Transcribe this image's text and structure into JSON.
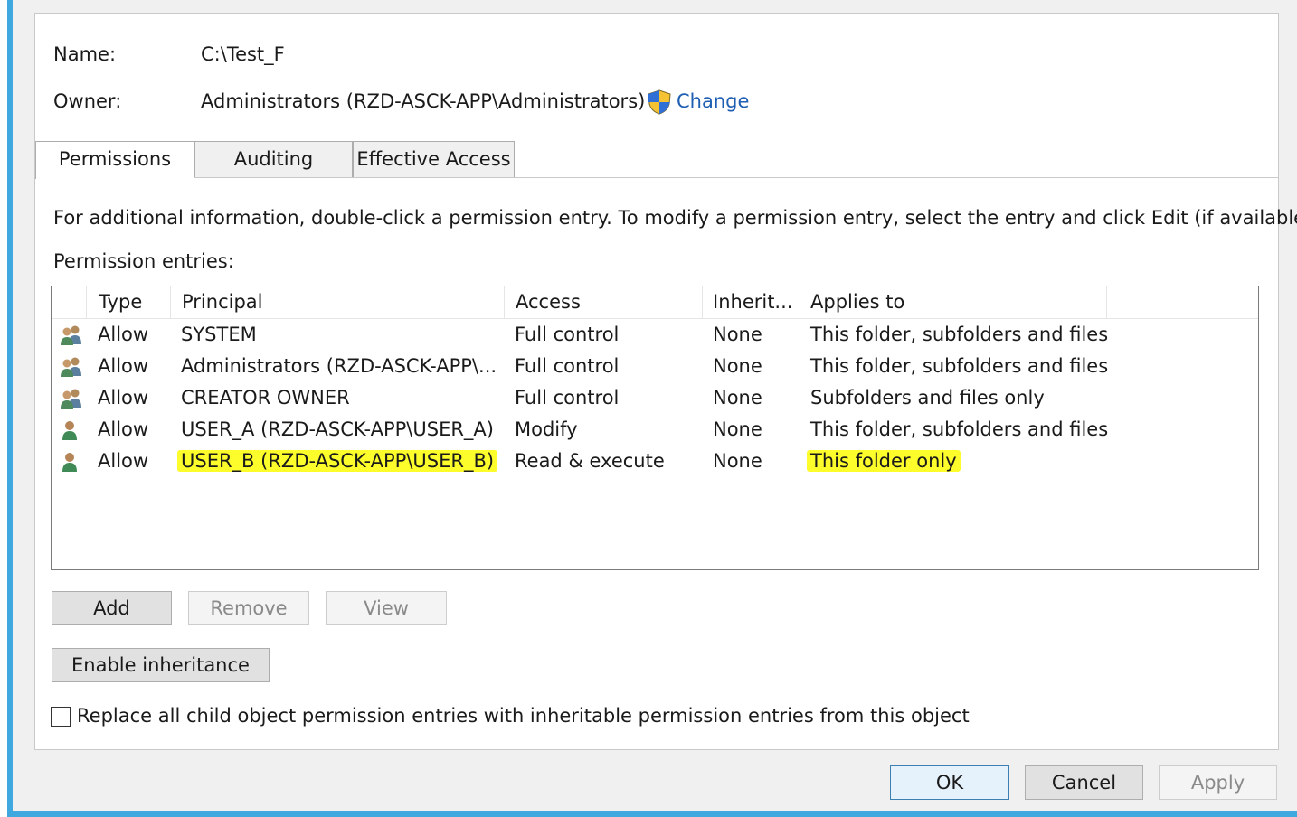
{
  "object": {
    "name_label": "Name:",
    "name_value": "C:\\Test_F",
    "owner_label": "Owner:",
    "owner_value": "Administrators (RZD-ASCK-APP\\Administrators)",
    "change_link": "Change"
  },
  "tabs": [
    {
      "label": "Permissions",
      "active": true
    },
    {
      "label": "Auditing",
      "active": false
    },
    {
      "label": "Effective Access",
      "active": false
    }
  ],
  "info_text": "For additional information, double-click a permission entry. To modify a permission entry, select the entry and click Edit (if available).",
  "entries_label": "Permission entries:",
  "columns": {
    "type": "Type",
    "principal": "Principal",
    "access": "Access",
    "inherited": "Inherit...",
    "applies": "Applies to"
  },
  "entries": [
    {
      "icon": "group-icon",
      "type": "Allow",
      "principal": "SYSTEM",
      "access": "Full control",
      "inherited": "None",
      "applies": "This folder, subfolders and files"
    },
    {
      "icon": "group-icon",
      "type": "Allow",
      "principal": "Administrators (RZD-ASCK-APP\\...",
      "access": "Full control",
      "inherited": "None",
      "applies": "This folder, subfolders and files"
    },
    {
      "icon": "group-icon",
      "type": "Allow",
      "principal": "CREATOR OWNER",
      "access": "Full control",
      "inherited": "None",
      "applies": "Subfolders and files only"
    },
    {
      "icon": "user-icon",
      "type": "Allow",
      "principal": "USER_A (RZD-ASCK-APP\\USER_A)",
      "access": "Modify",
      "inherited": "None",
      "applies": "This folder, subfolders and files"
    },
    {
      "icon": "user-icon",
      "type": "Allow",
      "principal": "USER_B (RZD-ASCK-APP\\USER_B)",
      "access": "Read & execute",
      "inherited": "None",
      "applies": "This folder only",
      "highlighted": true
    }
  ],
  "buttons": {
    "add": "Add",
    "remove": "Remove",
    "view": "View",
    "enable_inheritance": "Enable inheritance"
  },
  "replace_checkbox": {
    "label": "Replace all child object permission entries with inheritable permission entries from this object",
    "checked": false
  },
  "dialog_buttons": {
    "ok": "OK",
    "cancel": "Cancel",
    "apply": "Apply"
  },
  "colors": {
    "highlight": "#fdfd2c",
    "link": "#1e5fb4",
    "frame": "#3fa9df"
  }
}
